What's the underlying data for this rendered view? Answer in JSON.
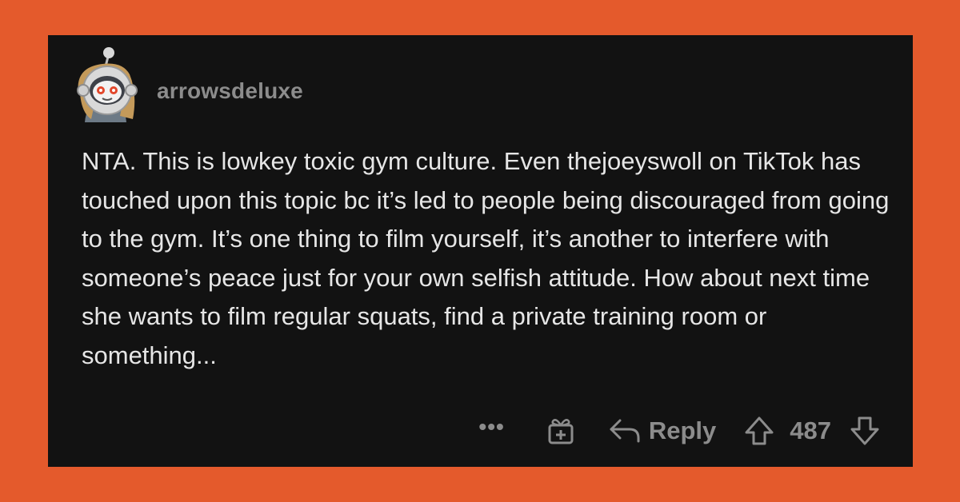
{
  "comment": {
    "username": "arrowsdeluxe",
    "body": "NTA. This is lowkey toxic gym culture. Even thejoeyswoll on TikTok has touched upon this topic bc it’s led to people being discouraged from going to the gym. It’s one thing to film yourself, it’s another to interfere with someone’s peace just for your own selfish attitude. How about next time she wants to film regular squats, find a private training room or something...",
    "actions": {
      "more_label": "•••",
      "reply_label": "Reply",
      "score": "487"
    }
  },
  "icons": {
    "avatar": "snoo-astronaut-avatar",
    "gift": "gift-icon",
    "reply": "reply-arrow-icon",
    "upvote": "upvote-arrow-icon",
    "downvote": "downvote-arrow-icon"
  },
  "colors": {
    "frame": "#e45a2c",
    "card": "#121212",
    "text": "#e6e6e6",
    "muted": "#8c8c8c"
  }
}
